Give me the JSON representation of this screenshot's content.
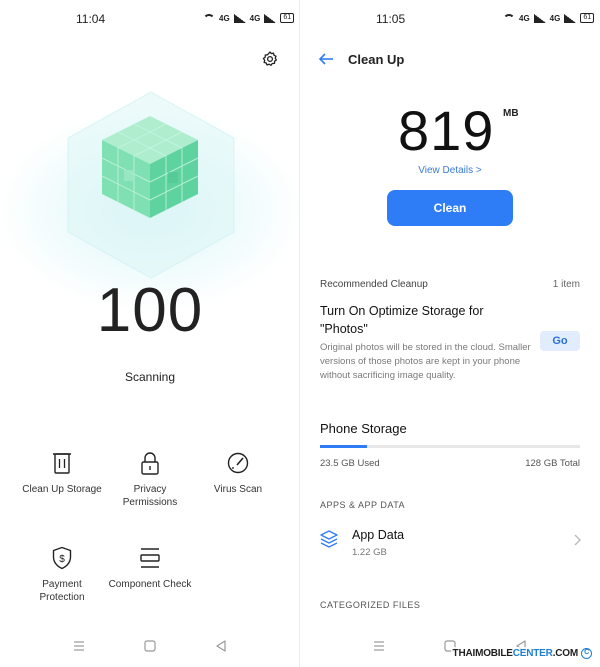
{
  "left_screen": {
    "status_bar": {
      "time": "11:04",
      "network": "4G",
      "battery": "61"
    },
    "settings_icon": "gear-icon",
    "score": "100",
    "status_label": "Scanning",
    "shortcuts": [
      {
        "label": "Clean Up Storage",
        "icon": "trash-icon"
      },
      {
        "label": "Privacy Permissions",
        "icon": "lock-icon"
      },
      {
        "label": "Virus Scan",
        "icon": "gauge-icon"
      },
      {
        "label": "Payment Protection",
        "icon": "shield-dollar-icon"
      },
      {
        "label": "Component Check",
        "icon": "component-icon"
      }
    ]
  },
  "right_screen": {
    "status_bar": {
      "time": "11:05",
      "network": "4G",
      "battery": "61"
    },
    "header": {
      "title": "Clean Up",
      "back_icon": "arrow-left-icon"
    },
    "junk_size": {
      "value": "819",
      "unit": "MB"
    },
    "view_details_label": "View Details >",
    "clean_button_label": "Clean",
    "recommended": {
      "label": "Recommended Cleanup",
      "count": "1 item",
      "title": "Turn On Optimize Storage for \"Photos\"",
      "description": "Original photos will be stored in the cloud. Smaller versions of those photos are kept in your phone without sacrificing image quality.",
      "action_label": "Go"
    },
    "phone_storage": {
      "title": "Phone Storage",
      "used": "23.5 GB Used",
      "total": "128 GB Total",
      "used_fraction": 0.18
    },
    "apps_section": {
      "header": "APPS & APP DATA",
      "item": {
        "name": "App Data",
        "size": "1.22 GB",
        "icon": "layers-icon"
      }
    },
    "categorized_header": "CATEGORIZED FILES"
  },
  "watermark": {
    "prefix": "THAIMOBILE",
    "accent": "CENTER",
    "suffix": ".COM",
    "symbol": "C"
  },
  "colors": {
    "accent_blue": "#2f7df6",
    "cube_green": "#7fe0b4",
    "glow": "#bcecf0"
  }
}
